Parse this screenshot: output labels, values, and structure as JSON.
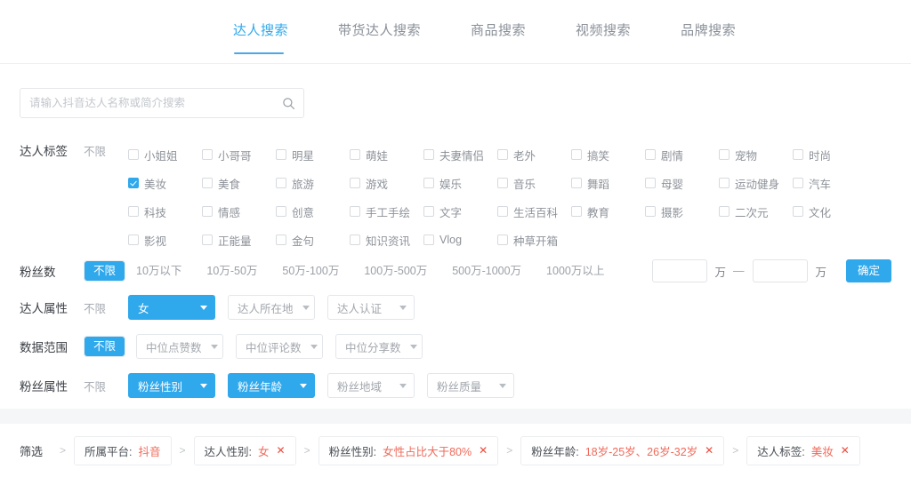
{
  "tabs": [
    {
      "label": "达人搜索",
      "active": true
    },
    {
      "label": "带货达人搜索",
      "active": false
    },
    {
      "label": "商品搜索",
      "active": false
    },
    {
      "label": "视频搜索",
      "active": false
    },
    {
      "label": "品牌搜索",
      "active": false
    }
  ],
  "search": {
    "placeholder": "请输入抖音达人名称或简介搜索",
    "value": "",
    "icon": "search-icon"
  },
  "colors": {
    "accent": "#2fa8ec",
    "tab_active": "#2fa8ec",
    "chip_value": "#ef6a5a",
    "chip_close": "#ef4b3c",
    "panel_bg": "#ffffff",
    "page_bg": "#f4f6f8"
  },
  "rows": {
    "tags": {
      "label": "达人标签",
      "any": "不限",
      "any_active": false,
      "items": [
        {
          "label": "小姐姐",
          "checked": false
        },
        {
          "label": "小哥哥",
          "checked": false
        },
        {
          "label": "明星",
          "checked": false
        },
        {
          "label": "萌娃",
          "checked": false
        },
        {
          "label": "夫妻情侣",
          "checked": false
        },
        {
          "label": "老外",
          "checked": false
        },
        {
          "label": "搞笑",
          "checked": false
        },
        {
          "label": "剧情",
          "checked": false
        },
        {
          "label": "宠物",
          "checked": false
        },
        {
          "label": "时尚",
          "checked": false
        },
        {
          "label": "美妆",
          "checked": true
        },
        {
          "label": "美食",
          "checked": false
        },
        {
          "label": "旅游",
          "checked": false
        },
        {
          "label": "游戏",
          "checked": false
        },
        {
          "label": "娱乐",
          "checked": false
        },
        {
          "label": "音乐",
          "checked": false
        },
        {
          "label": "舞蹈",
          "checked": false
        },
        {
          "label": "母婴",
          "checked": false
        },
        {
          "label": "运动健身",
          "checked": false
        },
        {
          "label": "汽车",
          "checked": false
        },
        {
          "label": "科技",
          "checked": false
        },
        {
          "label": "情感",
          "checked": false
        },
        {
          "label": "创意",
          "checked": false
        },
        {
          "label": "手工手绘",
          "checked": false
        },
        {
          "label": "文字",
          "checked": false
        },
        {
          "label": "生活百科",
          "checked": false
        },
        {
          "label": "教育",
          "checked": false
        },
        {
          "label": "摄影",
          "checked": false
        },
        {
          "label": "二次元",
          "checked": false
        },
        {
          "label": "文化",
          "checked": false
        },
        {
          "label": "影视",
          "checked": false
        },
        {
          "label": "正能量",
          "checked": false
        },
        {
          "label": "金句",
          "checked": false
        },
        {
          "label": "知识资讯",
          "checked": false
        },
        {
          "label": "Vlog",
          "checked": false
        },
        {
          "label": "种草开箱",
          "checked": false
        }
      ]
    },
    "fans_count": {
      "label": "粉丝数",
      "any": "不限",
      "any_active": true,
      "options": [
        "10万以下",
        "10万-50万",
        "50万-100万",
        "100万-500万",
        "500万-1000万",
        "1000万以上"
      ],
      "min_value": "",
      "min_placeholder": "",
      "unit_min": "万",
      "separator": "—",
      "max_value": "",
      "max_placeholder": "",
      "unit_max": "万",
      "confirm_label": "确定"
    },
    "talent_attr": {
      "label": "达人属性",
      "any": "不限",
      "any_active": false,
      "dropdowns": [
        {
          "label": "女",
          "active": true
        },
        {
          "label": "达人所在地",
          "active": false
        },
        {
          "label": "达人认证",
          "active": false
        }
      ]
    },
    "data_range": {
      "label": "数据范围",
      "any": "不限",
      "any_active": true,
      "dropdowns": [
        {
          "label": "中位点赞数",
          "active": false
        },
        {
          "label": "中位评论数",
          "active": false
        },
        {
          "label": "中位分享数",
          "active": false
        }
      ]
    },
    "fans_attr": {
      "label": "粉丝属性",
      "any": "不限",
      "any_active": false,
      "dropdowns": [
        {
          "label": "粉丝性别",
          "active": true
        },
        {
          "label": "粉丝年龄",
          "active": true
        },
        {
          "label": "粉丝地域",
          "active": false
        },
        {
          "label": "粉丝质量",
          "active": false
        }
      ]
    }
  },
  "filter_bar": {
    "label": "筛选",
    "separator": ">",
    "chips": [
      {
        "key": "所属平台:",
        "value": "抖音",
        "closable": false,
        "close": "✕"
      },
      {
        "key": "达人性别:",
        "value": "女",
        "closable": true,
        "close": "✕"
      },
      {
        "key": "粉丝性别:",
        "value": "女性占比大于80%",
        "closable": true,
        "close": "✕"
      },
      {
        "key": "粉丝年龄:",
        "value": "18岁-25岁、26岁-32岁",
        "closable": true,
        "close": "✕"
      },
      {
        "key": "达人标签:",
        "value": "美妆",
        "closable": true,
        "close": "✕"
      }
    ]
  }
}
